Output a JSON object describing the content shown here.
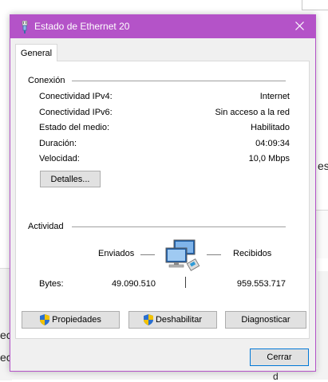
{
  "background": {
    "right_text_1": "es",
    "left_text_1": "ec",
    "left_text_2": "ec",
    "bottom_text": "d"
  },
  "window": {
    "title": "Estado de Ethernet 20",
    "accent_color": "#b453c8",
    "title_icon": "ethernet-icon",
    "close_icon": "close-icon"
  },
  "tabs": [
    {
      "label": "General"
    }
  ],
  "connection": {
    "heading": "Conexión",
    "rows": [
      {
        "label": "Conectividad IPv4:",
        "value": "Internet"
      },
      {
        "label": "Conectividad IPv6:",
        "value": "Sin acceso a la red"
      },
      {
        "label": "Estado del medio:",
        "value": "Habilitado"
      },
      {
        "label": "Duración:",
        "value": "04:09:34"
      },
      {
        "label": "Velocidad:",
        "value": "10,0 Mbps"
      }
    ],
    "details_button": "Detalles..."
  },
  "activity": {
    "heading": "Actividad",
    "sent_label": "Enviados",
    "received_label": "Recibidos",
    "bytes_label": "Bytes:",
    "bytes_sent": "49.090.510",
    "bytes_received": "959.553.717",
    "network_icon": "network-computers-icon"
  },
  "buttons": {
    "properties": "Propiedades",
    "disable": "Deshabilitar",
    "diagnose": "Diagnosticar",
    "close": "Cerrar"
  }
}
